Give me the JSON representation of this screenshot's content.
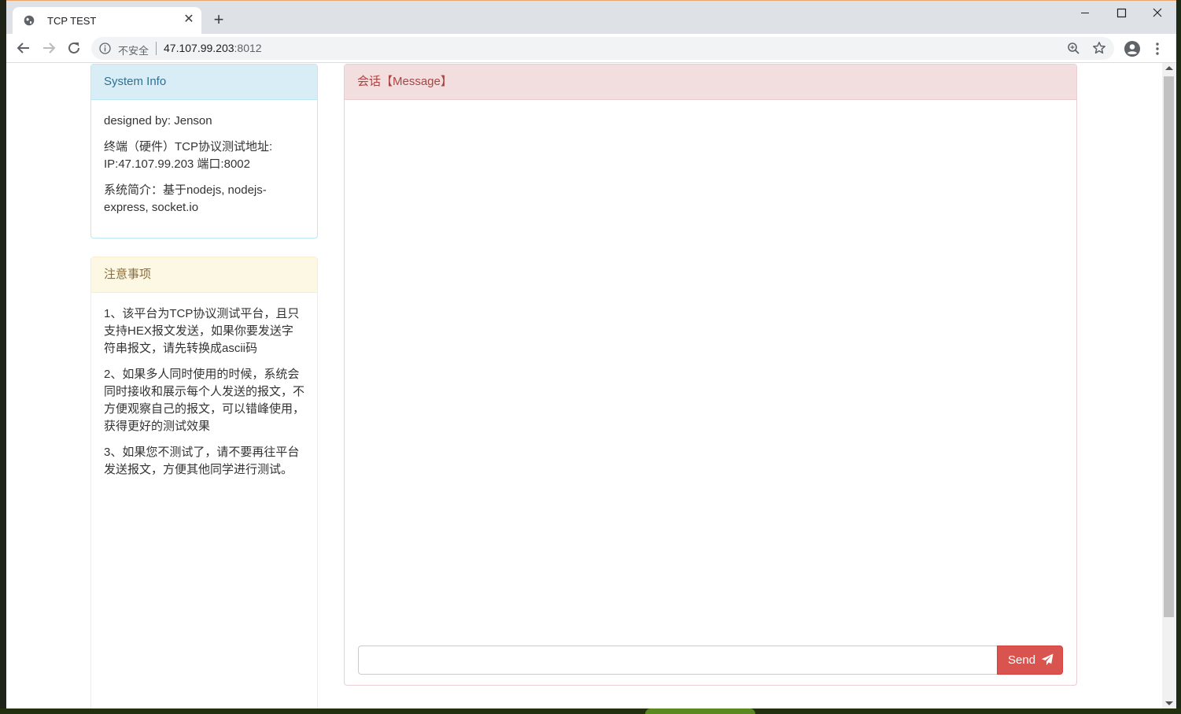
{
  "browser": {
    "tab_title": "TCP TEST",
    "new_tab_glyph": "+",
    "close_glyph": "✕",
    "insecure_label": "不安全",
    "url_host": "47.107.99.203",
    "url_port": ":8012"
  },
  "system_info": {
    "title": "System Info",
    "lines": [
      "designed by: Jenson",
      "终端（硬件）TCP协议测试地址: IP:47.107.99.203 端口:8002",
      "系统简介：基于nodejs, nodejs-express, socket.io"
    ]
  },
  "notice": {
    "title": "注意事项",
    "items": [
      "1、该平台为TCP协议测试平台，且只支持HEX报文发送，如果你要发送字符串报文，请先转换成ascii码",
      "2、如果多人同时使用的时候，系统会同时接收和展示每个人发送的报文，不方便观察自己的报文，可以错峰使用，获得更好的测试效果",
      "3、如果您不测试了，请不要再往平台发送报文，方便其他同学进行测试。"
    ]
  },
  "message_panel": {
    "title": "会话【Message】",
    "input_value": "",
    "send_label": "Send"
  },
  "colors": {
    "info_bg": "#d9edf7",
    "warn_bg": "#fcf8e3",
    "danger_bg": "#f2dede",
    "send_btn": "#d9534f"
  }
}
